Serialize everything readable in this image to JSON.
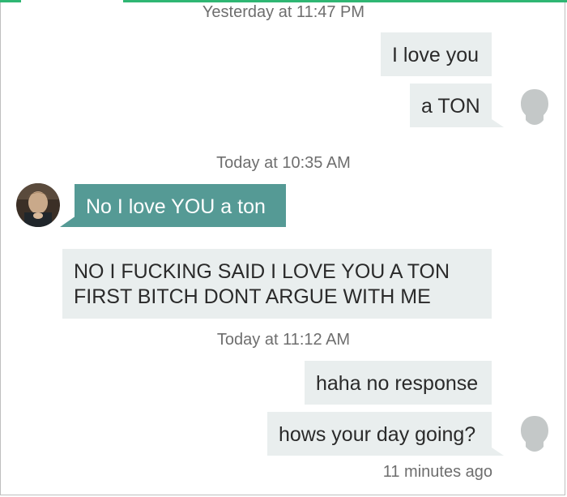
{
  "conversation": {
    "messages_group1": {
      "timestamp": "Yesterday at 11:47 PM",
      "bubbles": [
        "I love you",
        "a TON"
      ]
    },
    "messages_group2": {
      "timestamp": "Today at 10:35 AM",
      "incoming": "No I love YOU a ton",
      "outgoing_lines": [
        "NO I FUCKING SAID I LOVE YOU A TON",
        "FIRST BITCH DONT ARGUE WITH ME"
      ]
    },
    "messages_group3": {
      "timestamp": "Today at 11:12 AM",
      "bubbles": [
        "haha no response",
        "hows your day going?"
      ],
      "status": "11 minutes ago"
    }
  },
  "colors": {
    "accent_bubble": "#559a95",
    "neutral_bubble": "#e9eeee",
    "top_bar": "#2fb673"
  },
  "icons": {
    "avatar_self": "default-person-silhouette-icon",
    "avatar_other": "profile-photo"
  }
}
